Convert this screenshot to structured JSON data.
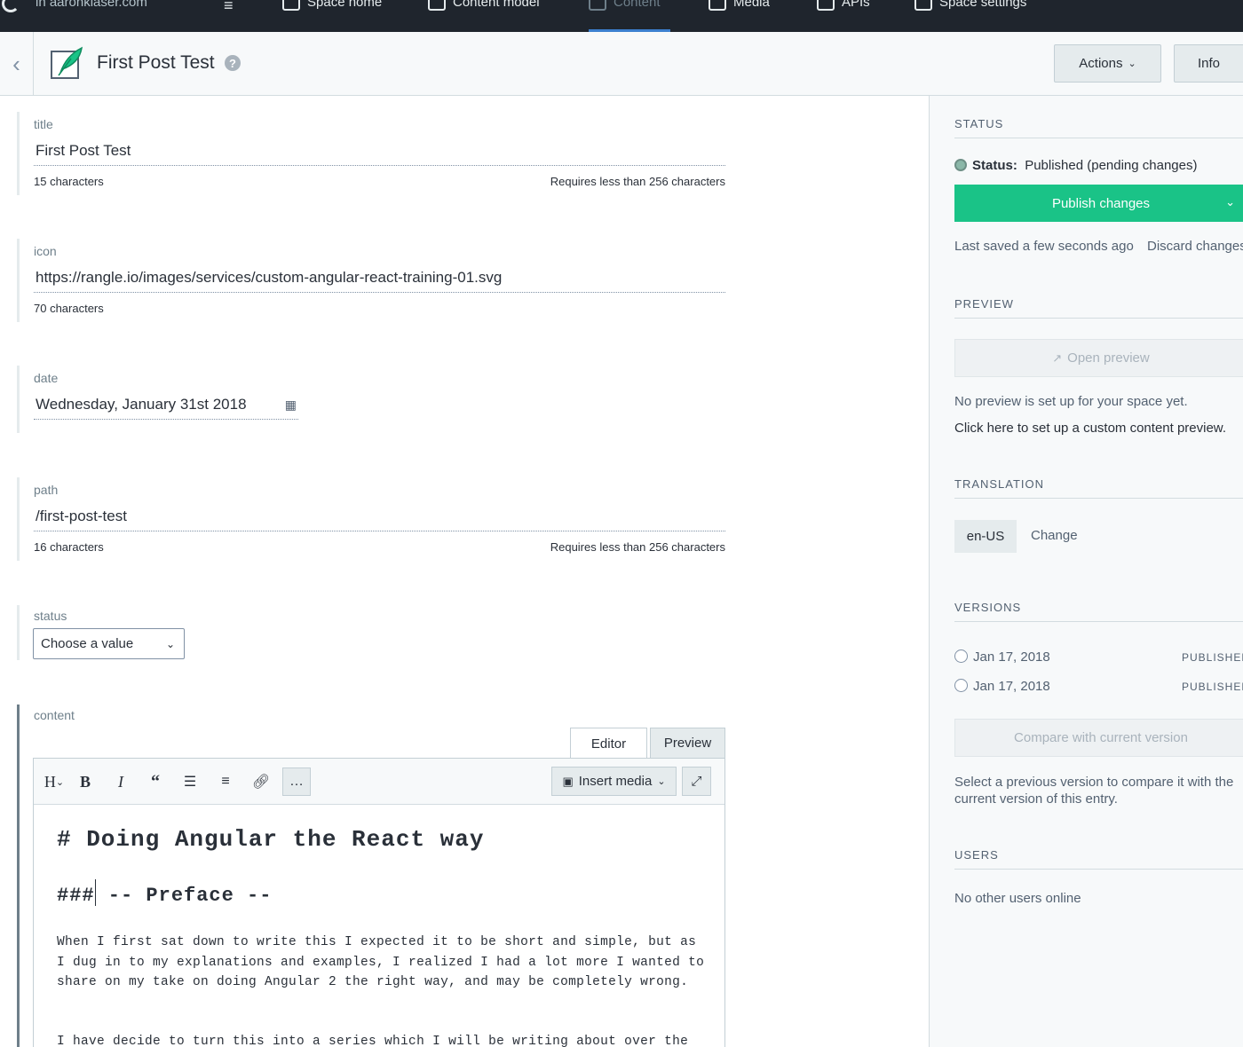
{
  "topnav": {
    "space_name": "in aaronklaser.com",
    "items": [
      {
        "label": "Space home",
        "icon": "home-icon"
      },
      {
        "label": "Content model",
        "icon": "cube-icon"
      },
      {
        "label": "Content",
        "icon": "pencil-icon",
        "active": true
      },
      {
        "label": "Media",
        "icon": "image-icon"
      },
      {
        "label": "APIs",
        "icon": "plug-icon"
      },
      {
        "label": "Space settings",
        "icon": "gear-icon"
      }
    ]
  },
  "header": {
    "title": "First Post Test",
    "actions_label": "Actions",
    "info_label": "Info"
  },
  "fields": {
    "title": {
      "label": "title",
      "value": "First Post Test",
      "count": "15 characters",
      "limit": "Requires less than 256 characters"
    },
    "icon": {
      "label": "icon",
      "value": "https://rangle.io/images/services/custom-angular-react-training-01.svg",
      "count": "70 characters"
    },
    "date": {
      "label": "date",
      "value": "Wednesday, January 31st 2018"
    },
    "path": {
      "label": "path",
      "value": "/first-post-test",
      "count": "16 characters",
      "limit": "Requires less than 256 characters"
    },
    "status": {
      "label": "status",
      "selected": "Choose a value"
    },
    "content": {
      "label": "content",
      "tab_editor": "Editor",
      "tab_preview": "Preview",
      "toolbar": {
        "heading": "H",
        "bold": "B",
        "italic": "I",
        "quote": "66",
        "more": "…",
        "insert_media": "Insert media"
      },
      "h1": "# Doing Angular the React way",
      "h3_prefix": "###",
      "h3_rest": " -- Preface --",
      "p1": "When I first sat down to write this I expected it to be short and simple, but as I dug in to my explanations and examples, I realized I had a lot more I wanted to share on my take on doing Angular 2 the right way, and may be completely wrong.",
      "p2": "I have decide to turn this into a series which I will be writing about over the"
    }
  },
  "sidebar": {
    "status_heading": "STATUS",
    "status_label": "Status:",
    "status_value": "Published (pending changes)",
    "publish_label": "Publish changes",
    "last_saved": "Last saved a few seconds ago",
    "discard": "Discard changes",
    "preview_heading": "PREVIEW",
    "open_preview": "Open preview",
    "preview_note_1": "No preview is set up for your space yet.",
    "preview_note_2": "Click here to set up a custom content preview.",
    "translation_heading": "TRANSLATION",
    "locale": "en-US",
    "change": "Change",
    "versions_heading": "VERSIONS",
    "versions": [
      {
        "date": "Jan 17, 2018",
        "badge": "PUBLISHED"
      },
      {
        "date": "Jan 17, 2018",
        "badge": "PUBLISHED"
      }
    ],
    "compare_label": "Compare with current version",
    "compare_note": "Select a previous version to compare it with the current version of this entry.",
    "users_heading": "USERS",
    "users_note": "No other users online"
  },
  "colors": {
    "accent": "#3c80cf",
    "publish": "#1ac387",
    "nav": "#1f252d"
  }
}
